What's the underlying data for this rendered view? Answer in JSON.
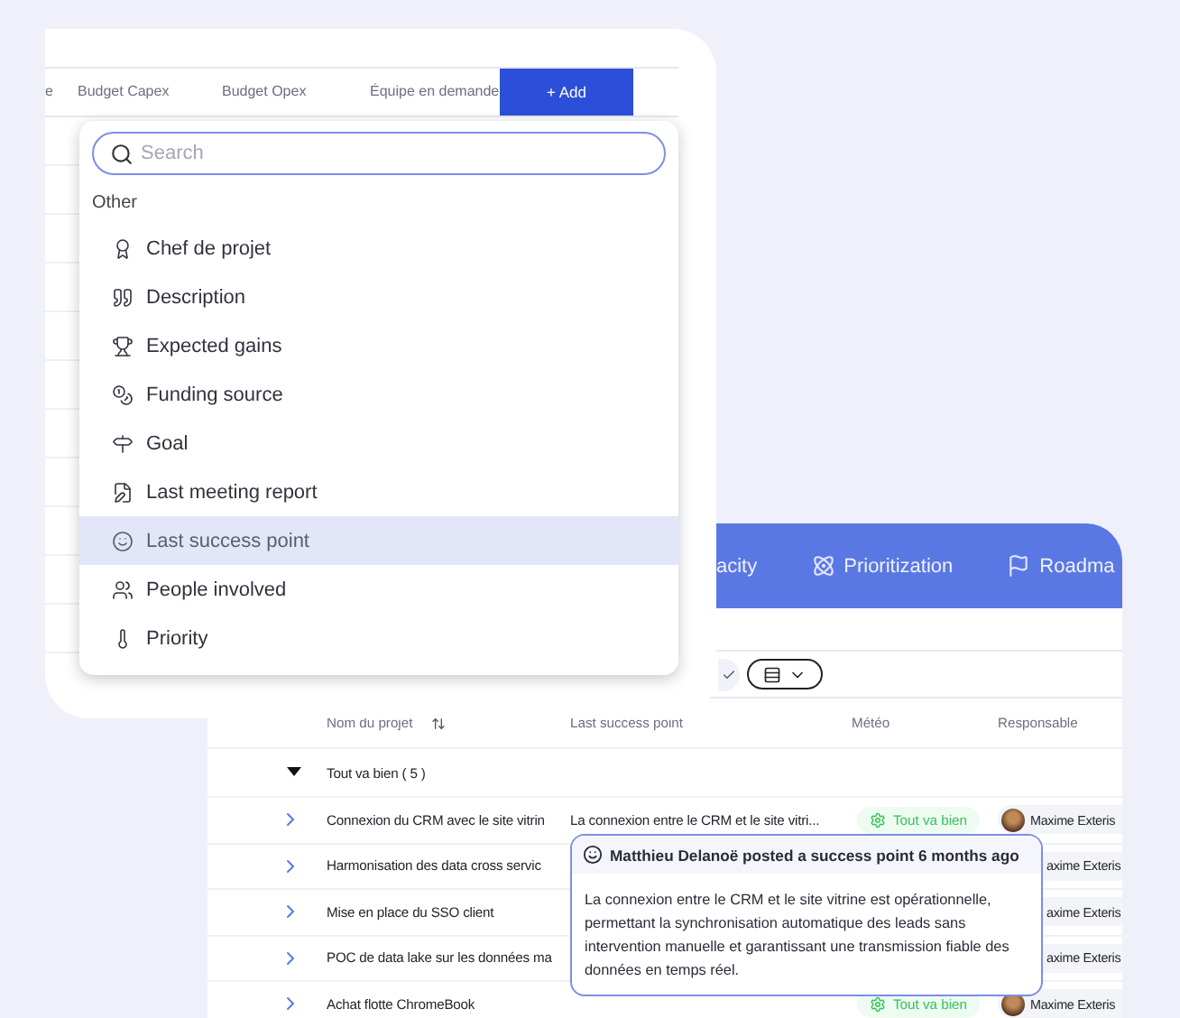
{
  "columns_header": {
    "columns": [
      "e",
      "Budget Capex",
      "Budget Opex",
      "Équipe en demande"
    ],
    "add_button": "+ Add"
  },
  "field_menu": {
    "search": {
      "placeholder": "Search"
    },
    "section": "Other",
    "items": [
      {
        "label": "Chef de projet",
        "selected": false
      },
      {
        "label": "Description",
        "selected": false
      },
      {
        "label": "Expected gains",
        "selected": false
      },
      {
        "label": "Funding source",
        "selected": false
      },
      {
        "label": "Goal",
        "selected": false
      },
      {
        "label": "Last meeting report",
        "selected": false
      },
      {
        "label": "Last success point",
        "selected": true
      },
      {
        "label": "People involved",
        "selected": false
      },
      {
        "label": "Priority",
        "selected": false
      }
    ]
  },
  "nav_tabs": [
    {
      "label": "acity"
    },
    {
      "label": "Prioritization"
    },
    {
      "label": "Roadma"
    }
  ],
  "table": {
    "columns": [
      "Nom du projet",
      "Last success point",
      "Météo",
      "Responsable"
    ],
    "group": {
      "label": "Tout va bien ( 5 )",
      "expanded": true
    },
    "rows": [
      {
        "name": "Connexion du CRM avec le site vitrin",
        "last_success": "La connexion entre le CRM et le site vitri...",
        "meteo": "Tout va bien",
        "responsable": "Maxime Exteris",
        "avatar": true
      },
      {
        "name": "Harmonisation des data cross servic",
        "responsable": "axime Exteris",
        "avatar": false
      },
      {
        "name": "Mise en place du SSO client",
        "responsable": "axime Exteris",
        "avatar": false
      },
      {
        "name": "POC de data lake sur les données ma",
        "responsable": "axime Exteris",
        "avatar": false
      },
      {
        "name": "Achat flotte ChromeBook",
        "meteo": "Tout va bien",
        "responsable": "Maxime Exteris",
        "avatar": true
      }
    ]
  },
  "popover": {
    "title": "Matthieu Delanoë posted a success point 6 months ago",
    "body": "La connexion entre le CRM et le site vitrine est opérationnelle, permettant la synchronisation automatique des leads sans intervention manuelle et garantissant une transmission fiable des données en temps réel."
  }
}
